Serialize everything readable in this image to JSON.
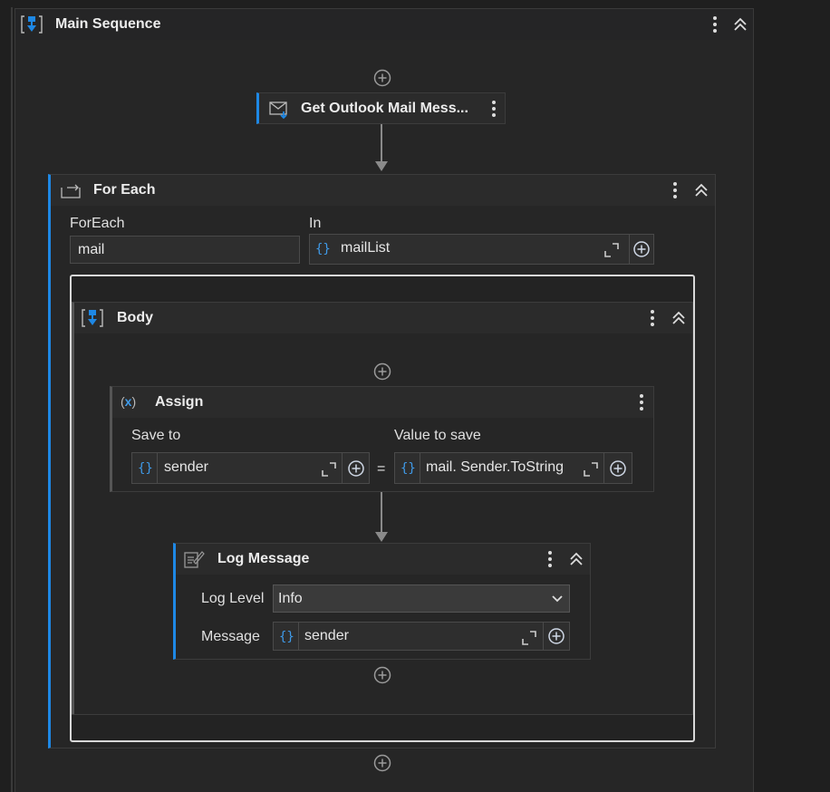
{
  "main_sequence": {
    "title": "Main Sequence"
  },
  "outlook_activity": {
    "title": "Get Outlook Mail Mess..."
  },
  "for_each": {
    "title": "For Each",
    "foreach_label": "ForEach",
    "foreach_value": "mail",
    "in_label": "In",
    "in_value": "mailList"
  },
  "body": {
    "title": "Body"
  },
  "assign": {
    "title": "Assign",
    "save_to_label": "Save to",
    "save_to_value": "sender",
    "equals": "=",
    "value_label": "Value to save",
    "value_value": "mail. Sender.ToString"
  },
  "log_message": {
    "title": "Log Message",
    "level_label": "Log Level",
    "level_value": "Info",
    "message_label": "Message",
    "message_value": "sender"
  },
  "colors": {
    "accent": "#1e88e5",
    "background": "#1f1f1f",
    "panel": "#2b2b2b"
  }
}
